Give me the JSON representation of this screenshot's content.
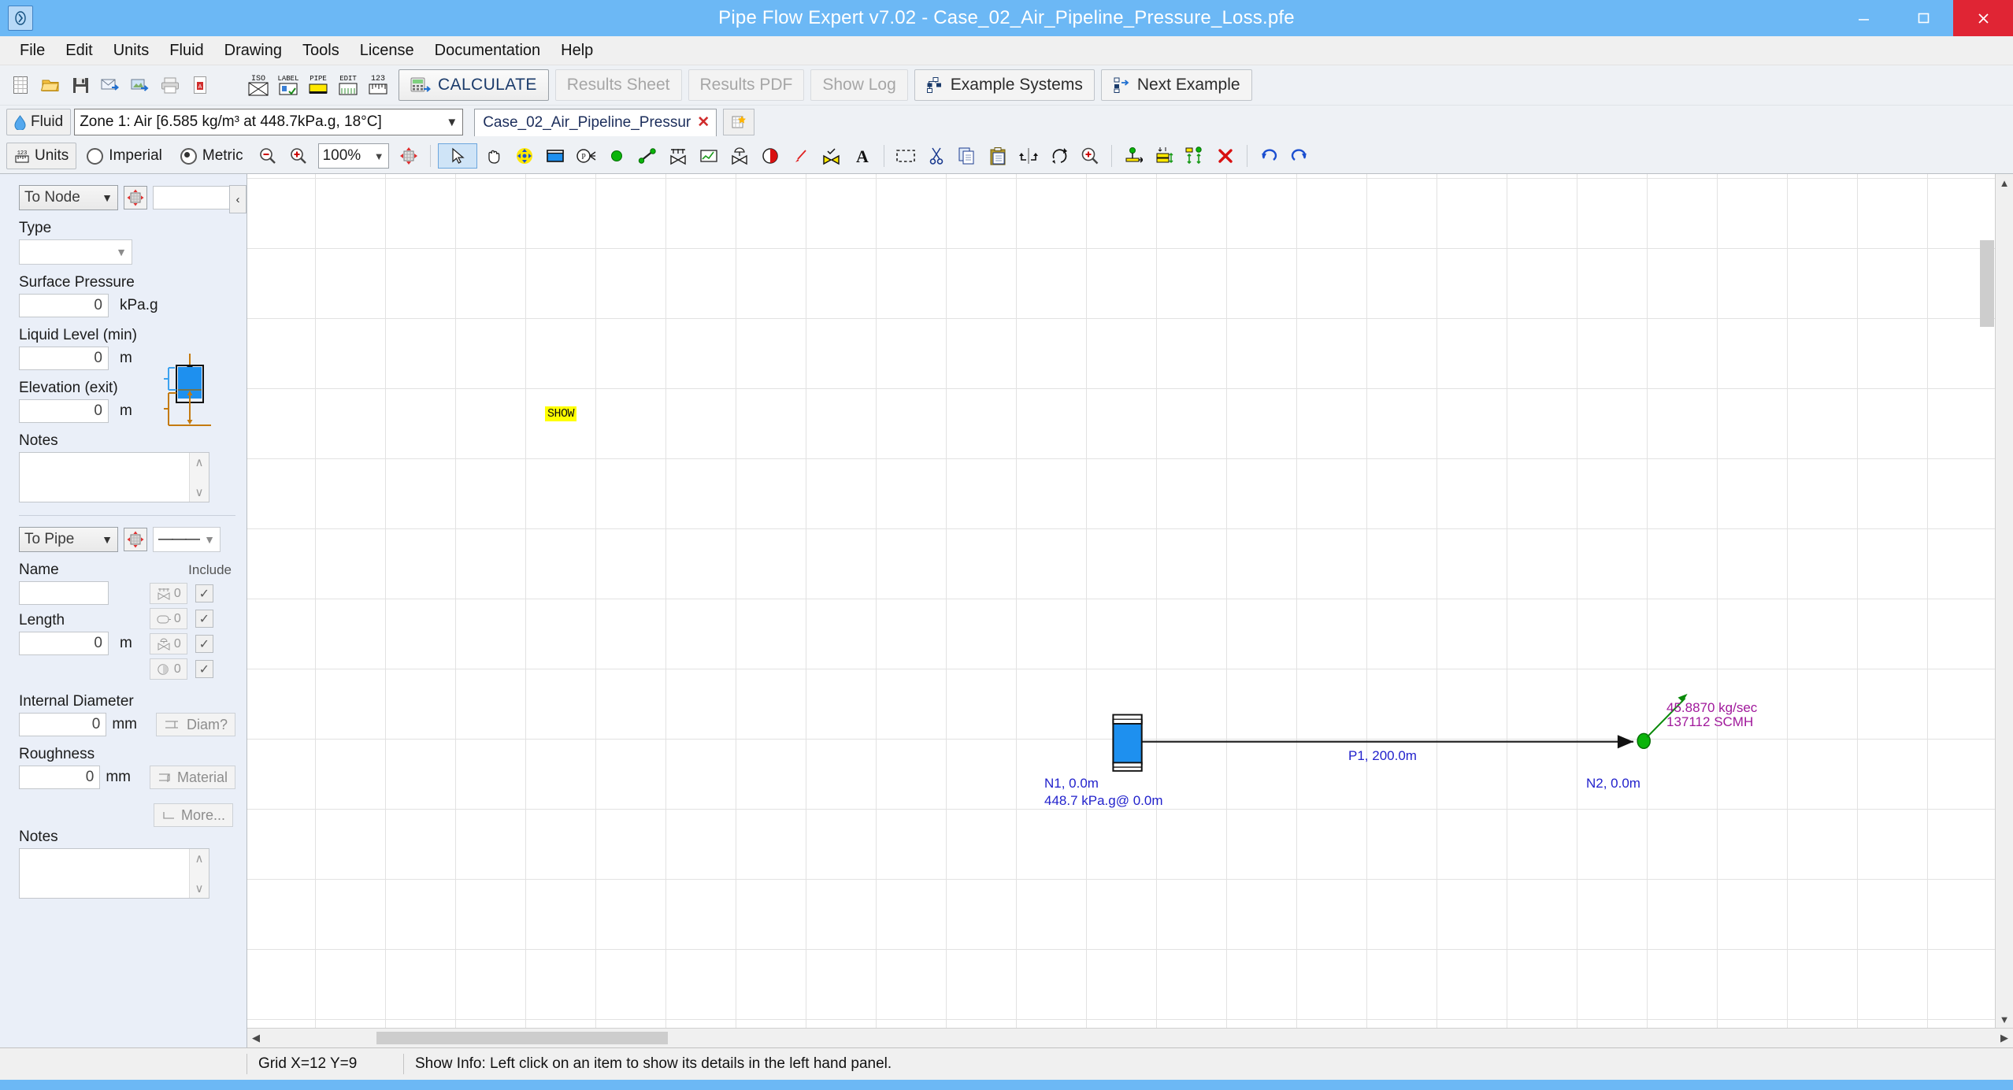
{
  "window": {
    "title": "Pipe Flow Expert v7.02 - Case_02_Air_Pipeline_Pressure_Loss.pfe",
    "app_icon": "app-logo-icon",
    "minimize": "–",
    "maximize": "❐",
    "close": "✕"
  },
  "menu": {
    "items": [
      {
        "label": "File"
      },
      {
        "label": "Edit"
      },
      {
        "label": "Units"
      },
      {
        "label": "Fluid"
      },
      {
        "label": "Drawing"
      },
      {
        "label": "Tools"
      },
      {
        "label": "License"
      },
      {
        "label": "Documentation"
      },
      {
        "label": "Help"
      }
    ]
  },
  "toolbar_file": {
    "icons": [
      {
        "name": "new-file-icon"
      },
      {
        "name": "open-folder-icon"
      },
      {
        "name": "save-icon"
      },
      {
        "name": "email-icon"
      },
      {
        "name": "export-image-icon"
      },
      {
        "name": "print-icon"
      },
      {
        "name": "export-pdf-icon"
      }
    ],
    "labeled_icons": [
      {
        "name": "iso-view-icon",
        "label": "ISO"
      },
      {
        "name": "label-icon",
        "label": "LABEL"
      },
      {
        "name": "pipe-icon",
        "label": "PIPE"
      },
      {
        "name": "edit-icon",
        "label": "EDIT"
      },
      {
        "name": "units-icon",
        "label": "123"
      }
    ],
    "calculate_label": "CALCULATE",
    "results_sheet_label": "Results Sheet",
    "results_pdf_label": "Results PDF",
    "show_log_label": "Show Log",
    "example_systems_label": "Example Systems",
    "next_example_label": "Next Example"
  },
  "fluid_bar": {
    "fluid_button_label": "Fluid",
    "fluid_value": "Zone 1: Air [6.585 kg/m³ at 448.7kPa.g, 18°C]",
    "document_tab": "Case_02_Air_Pipeline_Pressur",
    "tab_close": "✕"
  },
  "units_bar": {
    "units_button_label": "Units",
    "imperial_label": "Imperial",
    "metric_label": "Metric",
    "selected_unit_system": "Metric",
    "zoom_level": "100%",
    "tools": [
      {
        "name": "zoom-out-icon"
      },
      {
        "name": "zoom-in-icon"
      },
      {
        "name": "fit-to-grid-icon"
      },
      {
        "name": "select-pointer-icon",
        "selected": true
      },
      {
        "name": "pan-hand-icon"
      },
      {
        "name": "move-node-icon"
      },
      {
        "name": "tank-icon"
      },
      {
        "name": "pressure-node-icon"
      },
      {
        "name": "join-node-icon"
      },
      {
        "name": "pipe-draw-icon"
      },
      {
        "name": "valve-icon"
      },
      {
        "name": "component-curve-icon"
      },
      {
        "name": "control-valve-icon"
      },
      {
        "name": "pump-icon"
      },
      {
        "name": "pencil-icon"
      },
      {
        "name": "check-valve-icon"
      },
      {
        "name": "text-tool-icon"
      },
      {
        "name": "marquee-select-icon"
      },
      {
        "name": "cut-icon"
      },
      {
        "name": "copy-icon"
      },
      {
        "name": "paste-icon"
      },
      {
        "name": "flip-horizontal-icon"
      },
      {
        "name": "rotate-icon"
      },
      {
        "name": "zoom-region-icon"
      },
      {
        "name": "node-align-right-icon"
      },
      {
        "name": "tank-align-icon"
      },
      {
        "name": "distribute-icon"
      },
      {
        "name": "delete-icon"
      },
      {
        "name": "undo-icon"
      },
      {
        "name": "redo-icon"
      }
    ]
  },
  "left_panel": {
    "node_section": {
      "selector_value": "To Node",
      "crosshair_icon": "target-node-icon",
      "name_value": "",
      "type_label": "Type",
      "type_value": "",
      "surface_pressure_label": "Surface Pressure",
      "surface_pressure_value": "0",
      "surface_pressure_unit": "kPa.g",
      "liquid_level_label": "Liquid Level (min)",
      "liquid_level_value": "0",
      "liquid_level_unit": "m",
      "elevation_label": "Elevation (exit)",
      "elevation_value": "0",
      "elevation_unit": "m",
      "notes_label": "Notes",
      "notes_value": "",
      "tank_diagram_icon": "tank-elevation-diagram-icon"
    },
    "pipe_section": {
      "selector_value": "To Pipe",
      "crosshair_icon": "target-pipe-icon",
      "linestyle_value": "———",
      "name_label": "Name",
      "name_value": "",
      "include_label": "Include",
      "fittings": [
        {
          "icon": "valve-fitting-icon",
          "count": "0",
          "checked": true
        },
        {
          "icon": "component-fitting-icon",
          "count": "0",
          "checked": true
        },
        {
          "icon": "control-valve-fitting-icon",
          "count": "0",
          "checked": true
        },
        {
          "icon": "pump-fitting-icon",
          "count": "0",
          "checked": true
        }
      ],
      "length_label": "Length",
      "length_value": "0",
      "length_unit": "m",
      "internal_diameter_label": "Internal Diameter",
      "internal_diameter_value": "0",
      "internal_diameter_unit": "mm",
      "diam_button_label": "Diam?",
      "roughness_label": "Roughness",
      "roughness_value": "0",
      "roughness_unit": "mm",
      "material_button_label": "Material",
      "more_button_label": "More...",
      "notes_label": "Notes",
      "notes_value": ""
    },
    "collapse_icon": "collapse-panel-icon"
  },
  "canvas": {
    "show_tag": "SHOW",
    "diagram": {
      "tank_node": {
        "icon": "vertical-tank-icon",
        "label_line1": "N1, 0.0m",
        "label_line2": "448.7 kPa.g@ 0.0m"
      },
      "pipe": {
        "label": "P1, 200.0m",
        "arrow_icon": "flow-arrow-icon"
      },
      "end_node": {
        "label": "N2, 0.0m",
        "icon": "demand-node-icon"
      },
      "flow_out": {
        "line1": "45.8870 kg/sec",
        "line2": "137112 SCMH",
        "arrow_icon": "green-flow-arrow-icon"
      }
    },
    "scroll_left_icon": "scroll-left-icon",
    "scroll_right_icon": "scroll-right-icon",
    "scroll_up_icon": "scroll-up-icon",
    "scroll_down_icon": "scroll-down-icon"
  },
  "statusbar": {
    "grid": "Grid  X=12  Y=9",
    "info": "Show Info: Left click on an item to show its details in the left hand panel."
  },
  "colors": {
    "titlebar": "#6cb8f5",
    "close": "#e02534",
    "accent_blue": "#2222cc",
    "magenta": "#a0189b",
    "green": "#0a8a0a",
    "tank_blue": "#1e90ef",
    "highlight_yellow": "#ffff00"
  }
}
